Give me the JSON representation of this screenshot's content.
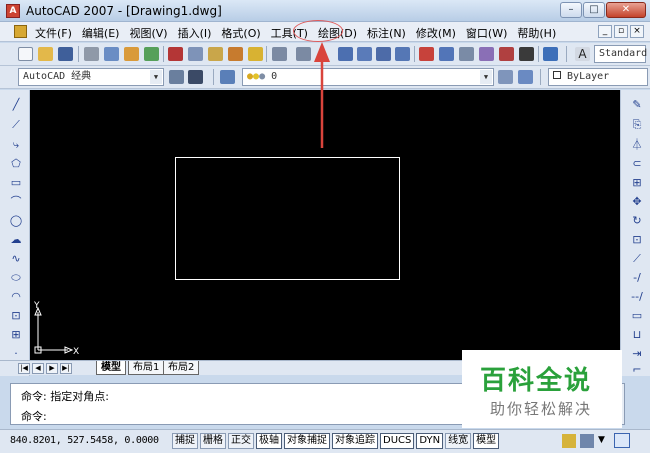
{
  "window": {
    "title": "AutoCAD 2007 - [Drawing1.dwg]"
  },
  "menus": [
    "文件(F)",
    "编辑(E)",
    "视图(V)",
    "插入(I)",
    "格式(O)",
    "工具(T)",
    "绘图(D)",
    "标注(N)",
    "修改(M)",
    "窗口(W)",
    "帮助(H)"
  ],
  "toolbar": {
    "text_style": "Standard",
    "workspace": "AutoCAD 经典",
    "layer": "0",
    "color": "ByLayer"
  },
  "canvas": {
    "x_axis": "X",
    "y_axis": "Y"
  },
  "tabs": [
    "模型",
    "布局1",
    "布局2"
  ],
  "command": {
    "line1": "命令: 指定对角点:",
    "line2": "命令:"
  },
  "status": {
    "coords": "840.8201,  527.5458, 0.0000",
    "toggles": [
      "捕捉",
      "栅格",
      "正交",
      "极轴",
      "对象捕捉",
      "对象追踪",
      "DUCS",
      "DYN",
      "线宽",
      "模型"
    ]
  },
  "watermark": {
    "brand": "百科全说",
    "tagline": "助你轻松解决"
  },
  "colors": {
    "canvas": "#000000",
    "highlight": "#e05a5a",
    "watermark_green": "#2aa13b"
  }
}
